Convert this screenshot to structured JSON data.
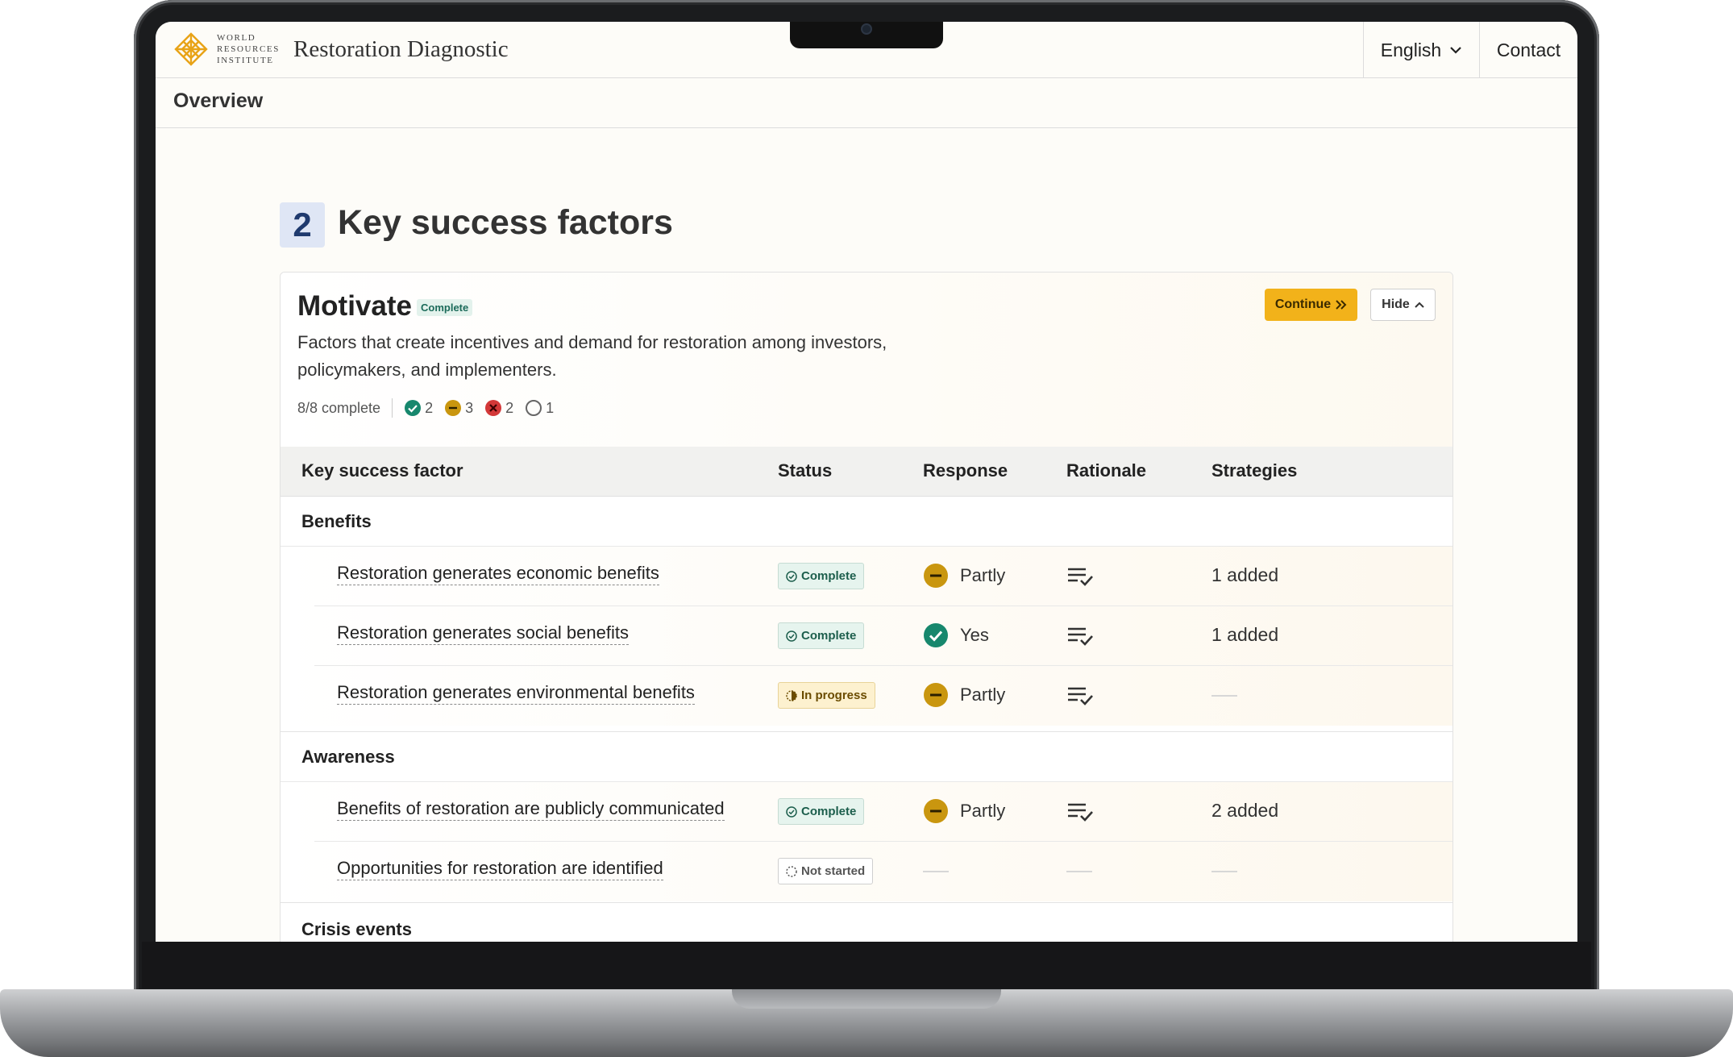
{
  "header": {
    "logo_text_lines": [
      "World",
      "Resources",
      "Institute"
    ],
    "app_title": "Restoration Diagnostic",
    "language": "English",
    "contact": "Contact"
  },
  "nav": {
    "overview": "Overview"
  },
  "section": {
    "number": "2",
    "title": "Key success factors"
  },
  "card": {
    "title": "Motivate",
    "badge": "Complete",
    "description": "Factors that create incentives and demand for restoration among investors, policymakers, and implementers.",
    "progress": "8/8 complete",
    "tallies": {
      "yes": "2",
      "partly": "3",
      "no": "2",
      "none": "1"
    },
    "continue_label": "Continue",
    "hide_label": "Hide"
  },
  "table": {
    "columns": [
      "Key success factor",
      "Status",
      "Response",
      "Rationale",
      "Strategies"
    ],
    "groups": [
      {
        "name": "Benefits",
        "rows": [
          {
            "factor": "Restoration generates economic benefits",
            "status": "Complete",
            "response": "Partly",
            "strategies": "1 added"
          },
          {
            "factor": "Restoration generates social benefits",
            "status": "Complete",
            "response": "Yes",
            "strategies": "1 added"
          },
          {
            "factor": "Restoration generates environmental benefits",
            "status": "In progress",
            "response": "Partly",
            "strategies": ""
          }
        ]
      },
      {
        "name": "Awareness",
        "rows": [
          {
            "factor": "Benefits of restoration are publicly communicated",
            "status": "Complete",
            "response": "Partly",
            "strategies": "2 added"
          },
          {
            "factor": "Opportunities for restoration are identified",
            "status": "Not started",
            "response": "",
            "strategies": ""
          }
        ]
      },
      {
        "name": "Crisis events",
        "rows": []
      }
    ]
  },
  "colors": {
    "accent": "#f2b21a",
    "yes": "#17876d",
    "partly": "#c9960f",
    "no": "#d33838",
    "section_badge": "#dfe6f5"
  },
  "icons": [
    "wri-logo-icon",
    "chevron-down-icon",
    "check-circle-icon",
    "minus-circle-icon",
    "x-circle-icon",
    "empty-circle-icon",
    "double-chevron-right-icon",
    "chevron-up-icon",
    "rationale-checklist-icon",
    "in-progress-icon",
    "not-started-icon"
  ]
}
